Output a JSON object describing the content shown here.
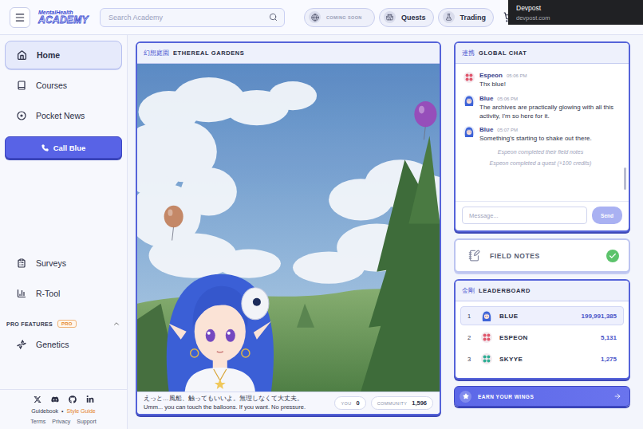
{
  "topbar": {
    "logo": {
      "line1": "MentalHealth",
      "line2": "ACADEMY"
    },
    "search": {
      "placeholder": "Search Academy"
    },
    "nav": [
      {
        "label": "COMING SOON",
        "kind": "soon"
      },
      {
        "label": "Quests",
        "kind": "quests"
      },
      {
        "label": "Trading",
        "kind": "trading"
      }
    ],
    "tooltip": {
      "title": "Devpost",
      "url": "devpost.com"
    }
  },
  "sidebar": {
    "items": [
      {
        "label": "Home",
        "kind": "home",
        "selected": true
      },
      {
        "label": "Courses",
        "kind": "courses",
        "selected": false
      },
      {
        "label": "Pocket News",
        "kind": "news",
        "selected": false
      }
    ],
    "call": {
      "label": "Call Blue"
    },
    "lower_items": [
      {
        "label": "Surveys",
        "kind": "surveys",
        "selected": false
      },
      {
        "label": "R-Tool",
        "kind": "rtool",
        "selected": false
      }
    ],
    "pro": {
      "title": "PRO FEATURES",
      "badge": "PRO",
      "expanded": true,
      "items": [
        {
          "label": "Genetics",
          "kind": "genetics",
          "selected": false
        }
      ]
    },
    "footer": {
      "links": [
        {
          "label": "Guidebook",
          "highlighted": false
        },
        {
          "label": "•",
          "highlighted": false
        },
        {
          "label": "Style Guide",
          "highlighted": true
        }
      ],
      "legal": [
        "Terms",
        "Privacy",
        "Support"
      ]
    }
  },
  "game": {
    "title_jp": "幻想庭園",
    "title": "ETHEREAL GARDENS",
    "balloons": [
      {
        "color": "#9a48b8"
      },
      {
        "color": "#c07f5a"
      },
      {
        "color": "#9b56c4"
      }
    ],
    "subtitle_jp": "えっと…風船、触ってもいいよ。無理しなくて大丈夫。",
    "subtitle_en": "Umm... you can touch the balloons. If you want. No pressure.",
    "counters": [
      {
        "label": "YOU",
        "value": "0"
      },
      {
        "label": "COMMUNITY",
        "value": "1,596"
      }
    ]
  },
  "chat": {
    "title_jp": "連携",
    "title": "GLOBAL CHAT",
    "messages": [
      {
        "kind": "message",
        "user": "Espeon",
        "time": "05:06 PM",
        "text": "Thx blue!",
        "avatar": "dots",
        "color": "#e0566b"
      },
      {
        "kind": "message",
        "user": "Blue",
        "time": "05:06 PM",
        "text": "The archives are practically glowing with all this activity, I'm so here for it.",
        "avatar": "portrait",
        "color": "#3d63d8"
      },
      {
        "kind": "message",
        "user": "Blue",
        "time": "05:07 PM",
        "text": "Something's starting to shake out there.",
        "avatar": "portrait",
        "color": "#3d63d8"
      },
      {
        "kind": "event",
        "text": "Espeon completed their field notes"
      },
      {
        "kind": "event",
        "text": "Espeon completed a quest (+100 credits)"
      }
    ],
    "input": {
      "placeholder": "Message..."
    },
    "send": "Send"
  },
  "field_notes": {
    "label": "FIELD NOTES",
    "done": true
  },
  "leaderboard": {
    "title_jp": "金剛",
    "title": "LEADERBOARD",
    "rows": [
      {
        "rank": "1",
        "name": "BLUE",
        "score": "199,991,385",
        "selected": true,
        "avatar": "portrait",
        "color": "#3d63d8"
      },
      {
        "rank": "2",
        "name": "ESPEON",
        "score": "5,131",
        "selected": false,
        "avatar": "dots",
        "color": "#e0566b"
      },
      {
        "rank": "3",
        "name": "SKYYE",
        "score": "1,275",
        "selected": false,
        "avatar": "dots",
        "color": "#2fae94"
      }
    ]
  },
  "cta": {
    "label": "EARN YOUR WINGS"
  }
}
